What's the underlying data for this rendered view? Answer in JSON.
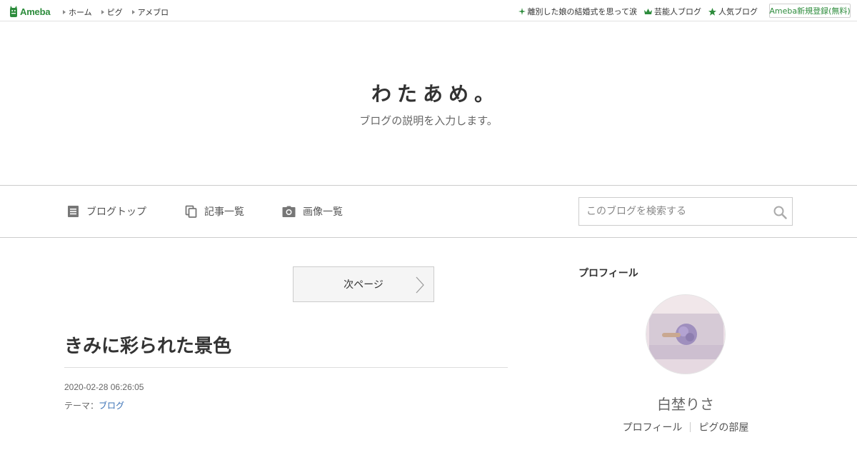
{
  "globalbar": {
    "logo_text": "Ameba",
    "nav": [
      "ホーム",
      "ピグ",
      "アメブロ"
    ],
    "right_links": [
      {
        "icon": "sparkle-icon",
        "label": "離別した娘の結婚式を思って涙"
      },
      {
        "icon": "crown-icon",
        "label": "芸能人ブログ"
      },
      {
        "icon": "star-icon",
        "label": "人気ブログ"
      }
    ],
    "register_label": "Ameba新規登録(無料)",
    "brand_color": "#2d8c3c"
  },
  "header": {
    "title": "わたあめ。",
    "description": "ブログの説明を入力します。"
  },
  "blognav": {
    "items": [
      {
        "icon": "document-icon",
        "label": "ブログトップ"
      },
      {
        "icon": "copy-icon",
        "label": "記事一覧"
      },
      {
        "icon": "camera-icon",
        "label": "画像一覧"
      }
    ],
    "search_placeholder": "このブログを検索する"
  },
  "main": {
    "next_page_label": "次ページ",
    "entry": {
      "title": "きみに彩られた景色",
      "date": "2020-02-28 06:26:05",
      "theme_label": "テーマ：",
      "theme_value": "ブログ"
    },
    "link_color": "#3970b5"
  },
  "sidebar": {
    "heading": "プロフィール",
    "name": "白埜りさ",
    "links": [
      "プロフィール",
      "ピグの部屋"
    ]
  }
}
